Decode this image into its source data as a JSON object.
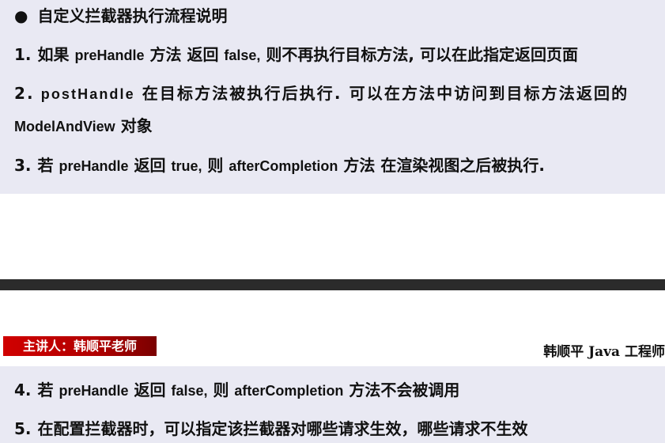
{
  "top_slide": {
    "heading": "自定义拦截器执行流程说明",
    "bullet": "●",
    "items": [
      {
        "num": "1.",
        "parts": [
          "如果 ",
          "preHandle",
          " 方法 返回 ",
          "false,",
          " 则不再执行目标方法, 可以在此指定返回页面"
        ]
      },
      {
        "num": "2.",
        "parts": [
          "postHandle",
          " 在目标方法被执行后执行. 可以在方法中访问到目标方法返回的",
          "ModelAndView",
          " 对象"
        ]
      },
      {
        "num": "3.",
        "parts": [
          "若 ",
          "preHandle",
          " 返回 ",
          "true,",
          " 则 ",
          "afterCompletion",
          " 方法 在渲染视图之后被执行."
        ]
      }
    ]
  },
  "bottom_slide": {
    "lecturer_badge": "主讲人：韩顺平老师",
    "author_credit": "韩顺平 Java 工程师",
    "items": [
      {
        "num": "4.",
        "parts": [
          "若 ",
          "preHandle",
          " 返回 ",
          "false,",
          " 则 ",
          "afterCompletion",
          " 方法不会被调用"
        ]
      },
      {
        "num": "5.",
        "parts": [
          "在配置拦截器时，可以指定该拦截器对哪些请求生效，哪些请求不生效"
        ]
      }
    ]
  }
}
